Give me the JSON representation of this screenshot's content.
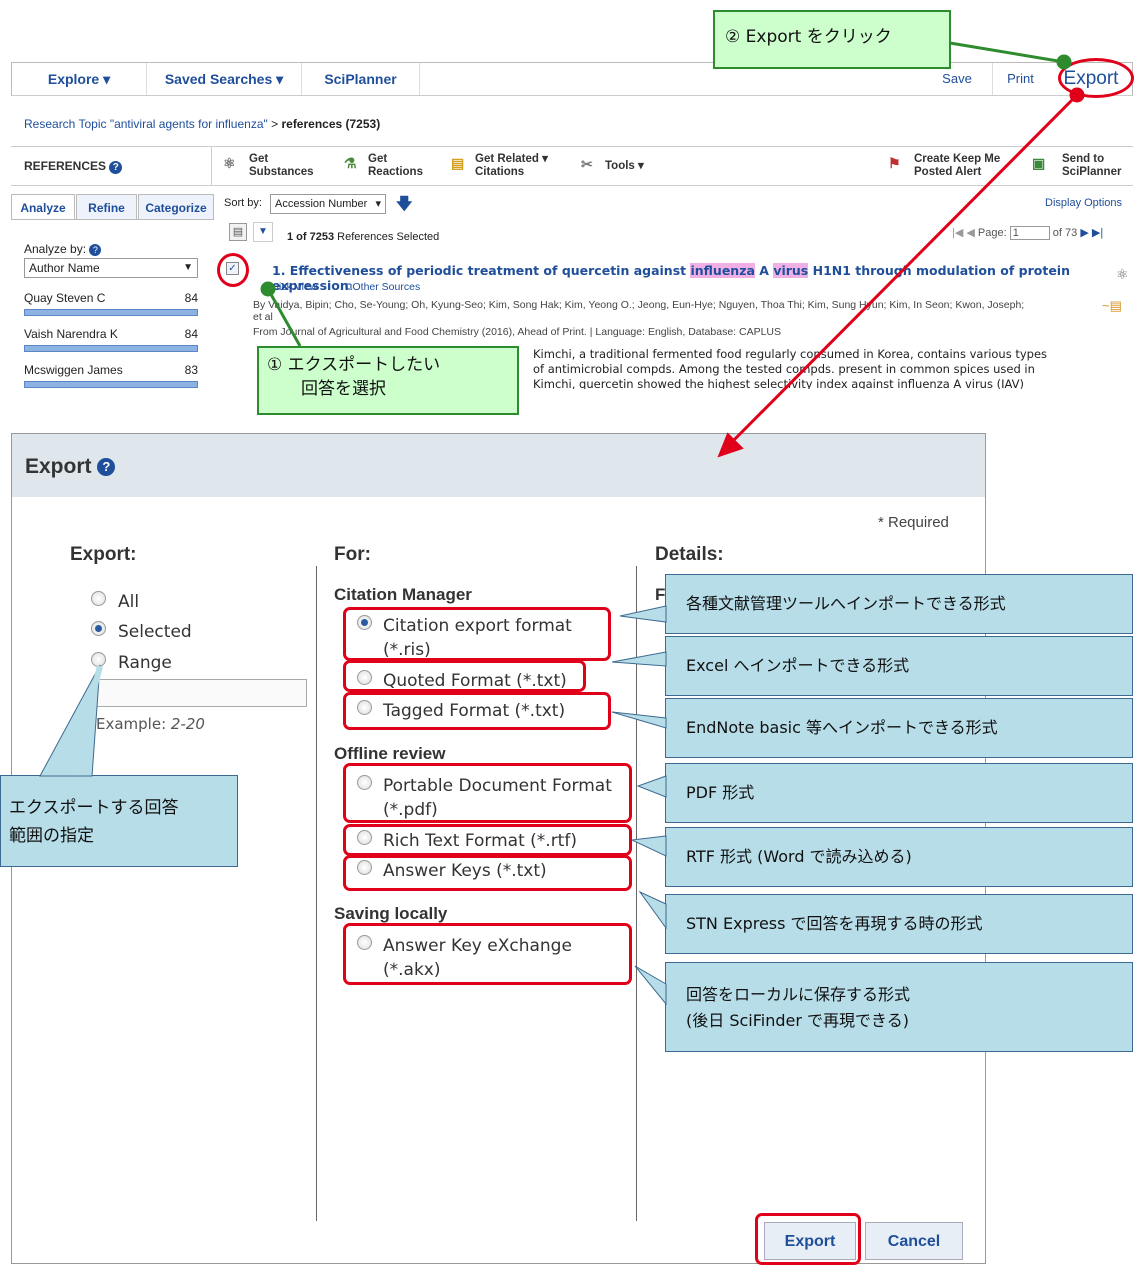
{
  "nav": {
    "explore": "Explore ▾",
    "saved": "Saved Searches ▾",
    "sciplanner": "SciPlanner",
    "save": "Save",
    "print": "Print",
    "export": "Export"
  },
  "breadcrumb": {
    "topic": "Research Topic \"antiviral agents for influenza\"",
    "sep": ">",
    "current": "references (7253)"
  },
  "refbar": {
    "label": "REFERENCES",
    "get_substances": [
      "Get",
      "Substances"
    ],
    "get_reactions": [
      "Get",
      "Reactions"
    ],
    "get_related": [
      "Get Related",
      "Citations"
    ],
    "tools": "Tools",
    "keep_me": [
      "Create Keep Me",
      "Posted Alert"
    ],
    "send_to": [
      "Send to",
      "SciPlanner"
    ]
  },
  "tabs": [
    "Analyze",
    "Refine",
    "Categorize"
  ],
  "sort": {
    "label": "Sort by:",
    "value": "Accession Number",
    "display_options": "Display Options"
  },
  "selection": {
    "text_bold": "1 of 7253",
    "text": "References Selected",
    "page_label": "Page:",
    "page_value": "1",
    "page_of": "of 73"
  },
  "analyze": {
    "label": "Analyze by:",
    "value": "Author Name",
    "authors": [
      {
        "name": "Quay Steven C",
        "count": "84"
      },
      {
        "name": "Vaish Narendra K",
        "count": "84"
      },
      {
        "name": "Mcswiggen James",
        "count": "83"
      }
    ]
  },
  "result": {
    "title_pre": "1.  Effectiveness of periodic treatment of quercetin against ",
    "hl1": "influenza",
    "title_mid": " A ",
    "hl2": "virus",
    "title_post": " H1N1 through modulation of protein expression",
    "quick_view": "Quick View",
    "other_sources": "Other Sources",
    "authors": "By Vaidya, Bipin; Cho, Se-Young; Oh, Kyung-Seo; Kim, Song Hak; Kim, Yeong O.; Jeong, Eun-Hye; Nguyen, Thoa Thi; Kim, Sung Hyun; Kim, In Seon; Kwon, Joseph;",
    "etal": "et al",
    "source": "From Journal of Agricultural and Food Chemistry (2016), Ahead of Print.  |  Language: English, Database: CAPLUS",
    "abstract1": "Kimchi, a traditional fermented food regularly consumed in Korea, contains various types",
    "abstract2": "of antimicrobial compds.  Among the tested compds. present in common spices used in",
    "abstract3": "Kimchi, quercetin showed the highest selectivity index against influenza A virus (IAV)"
  },
  "annotations": {
    "step1": [
      "① エクスポートしたい",
      "回答を選択"
    ],
    "step2": "② Export をクリック",
    "range_note": [
      "エクスポートする回答",
      "範囲の指定"
    ],
    "fmt_ris": "各種文献管理ツールへインポートできる形式",
    "fmt_quoted": "Excel へインポートできる形式",
    "fmt_tagged": "EndNote basic 等へインポートできる形式",
    "fmt_pdf": "PDF 形式",
    "fmt_rtf": "RTF 形式 (Word で読み込める)",
    "fmt_keys": "STN Express で回答を再現する時の形式",
    "fmt_akx": [
      "回答をローカルに保存する形式",
      "(後日 SciFinder で再現できる)"
    ]
  },
  "dialog": {
    "title": "Export",
    "required": "* Required",
    "export_head": "Export:",
    "for_head": "For:",
    "details_head": "Details:",
    "export_opts": [
      "All",
      "Selected",
      "Range"
    ],
    "example_label": "Example:",
    "example_value": "2-20",
    "citation_manager": "Citation Manager",
    "offline_review": "Offline review",
    "saving_locally": "Saving locally",
    "formats": {
      "ris": [
        "Citation export format",
        "(*.ris)"
      ],
      "quoted": "Quoted Format (*.txt)",
      "tagged": "Tagged Format (*.txt)",
      "pdf": [
        "Portable Document Format",
        "(*.pdf)"
      ],
      "rtf": "Rich Text Format (*.rtf)",
      "keys": "Answer Keys (*.txt)",
      "akx": [
        "Answer Key eXchange",
        "(*.akx)"
      ]
    },
    "details_f": "F",
    "export_btn": "Export",
    "cancel_btn": "Cancel"
  }
}
